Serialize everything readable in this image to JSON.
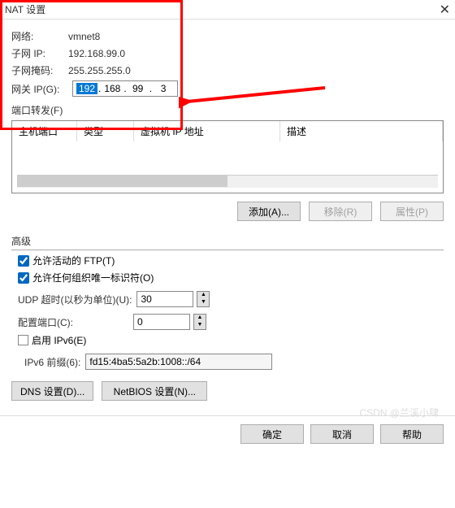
{
  "title": "NAT 设置",
  "network": {
    "label": "网络:",
    "value": "vmnet8"
  },
  "subnet_ip": {
    "label": "子网 IP:",
    "value": "192.168.99.0"
  },
  "subnet_mask": {
    "label": "子网掩码:",
    "value": "255.255.255.0"
  },
  "gateway": {
    "label": "网关 IP(G):",
    "seg1": "192",
    "seg2": "168",
    "seg3": "99",
    "seg4": "3"
  },
  "port_forward": {
    "label": "端口转发(F)"
  },
  "table": {
    "col_host": "主机端口",
    "col_type": "类型",
    "col_vmip": "虚拟机 IP 地址",
    "col_desc": "描述"
  },
  "buttons": {
    "add": "添加(A)...",
    "remove": "移除(R)",
    "props": "属性(P)"
  },
  "advanced": {
    "label": "高级"
  },
  "allow_ftp": {
    "label": "允许活动的 FTP(T)"
  },
  "allow_org": {
    "label": "允许任何组织唯一标识符(O)"
  },
  "udp_timeout": {
    "label": "UDP 超时(以秒为单位)(U):",
    "value": "30"
  },
  "config_port": {
    "label": "配置端口(C):",
    "value": "0"
  },
  "enable_ipv6": {
    "label": "启用 IPv6(E)"
  },
  "ipv6_prefix": {
    "label": "IPv6 前缀(6):",
    "value": "fd15:4ba5:5a2b:1008::/64"
  },
  "dns_btn": "DNS 设置(D)...",
  "netbios_btn": "NetBIOS 设置(N)...",
  "ok": "确定",
  "cancel": "取消",
  "help": "帮助",
  "watermark": "CSDN @兰溪小肆"
}
